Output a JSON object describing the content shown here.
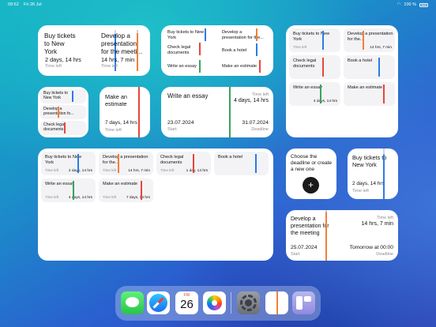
{
  "status_bar": {
    "time": "09:52",
    "date": "Fri 26 Jul",
    "battery": "100 %"
  },
  "labels": {
    "time_left": "Time left",
    "start": "Start",
    "deadline": "Deadline"
  },
  "tasks": {
    "tickets": {
      "title": "Buy tickets to New York",
      "remaining": "2 days, 14 hrs"
    },
    "presentation": {
      "title": "Develop a presentation for the meeting",
      "title_short": "Develop a presentation for the meeti...",
      "title_tiny": "Develop a presentation for the...",
      "title_mini": "Develop a presentation fo...",
      "remaining": "14 hrs, 7 min",
      "start_date": "25.07.2024",
      "deadline_text": "Tomorrow at 00:00"
    },
    "legal": {
      "title": "Check legal documents",
      "remaining": "1 day, 14 hrs"
    },
    "hotel": {
      "title": "Book a hotel"
    },
    "essay": {
      "title": "Write an essay",
      "remaining": "4 days, 14 hrs",
      "start_date": "23.07.2024",
      "deadline_date": "31.07.2024"
    },
    "estimate": {
      "title": "Make an estimate",
      "remaining": "7 days, 14 hrs"
    }
  },
  "choose_widget": {
    "text": "Choose the deadline or create a new one",
    "button": "+"
  },
  "calendar_icon": {
    "weekday": "FRI",
    "day": "26"
  },
  "dock_apps": [
    "messages-icon",
    "safari-icon",
    "calendar-icon",
    "photos-icon",
    "settings-icon",
    "deadline-app-icon",
    "widget-app-icon"
  ],
  "colors": {
    "blue": "#2b7be8",
    "red": "#e8453c",
    "green": "#3aa35a",
    "orange": "#f0803a",
    "gray": "#cfd4dc"
  }
}
